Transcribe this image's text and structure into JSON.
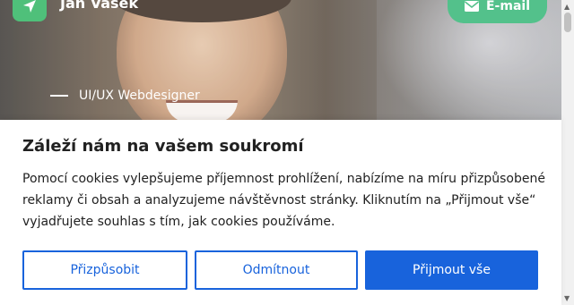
{
  "header": {
    "name": "Jan Vašek",
    "email_label": "E-mail",
    "subtitle": "UI/UX Webdesigner"
  },
  "consent": {
    "title": "Záleží nám na vašem soukromí",
    "text": "Pomocí cookies vylepšujeme příjemnost prohlížení, nabízíme na míru přizpůsobené reklamy či obsah a analyzujeme návštěvnost stránky. Kliknutím na „Přijmout vše“ vyjadřujete souhlas s tím, jak cookies používáme.",
    "customize_label": "Přizpůsobit",
    "reject_label": "Odmítnout",
    "accept_label": "Přijmout vše"
  },
  "colors": {
    "brand_green": "#53c18b",
    "primary_blue": "#1863dc"
  },
  "icons": {
    "logo": "send-arrow-icon",
    "email": "envelope-icon"
  }
}
